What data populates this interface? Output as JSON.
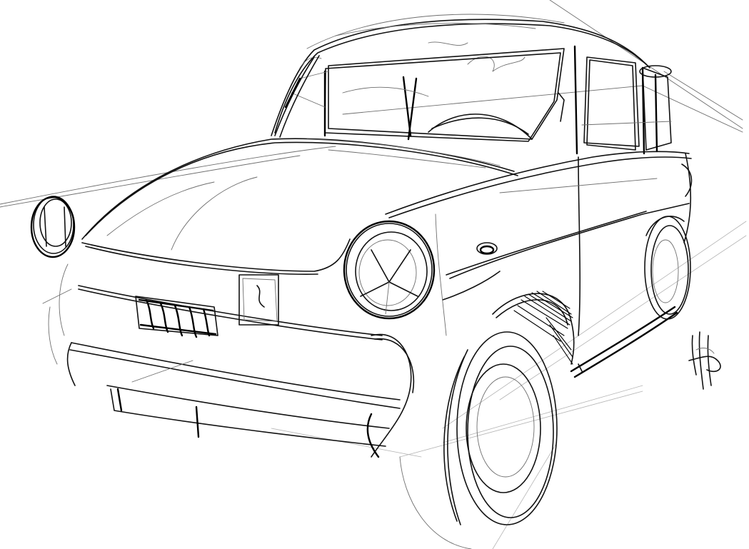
{
  "drawing": {
    "subject": "sketch-vintage-car",
    "background_color": "#ffffff",
    "ink_color": "#111111"
  }
}
